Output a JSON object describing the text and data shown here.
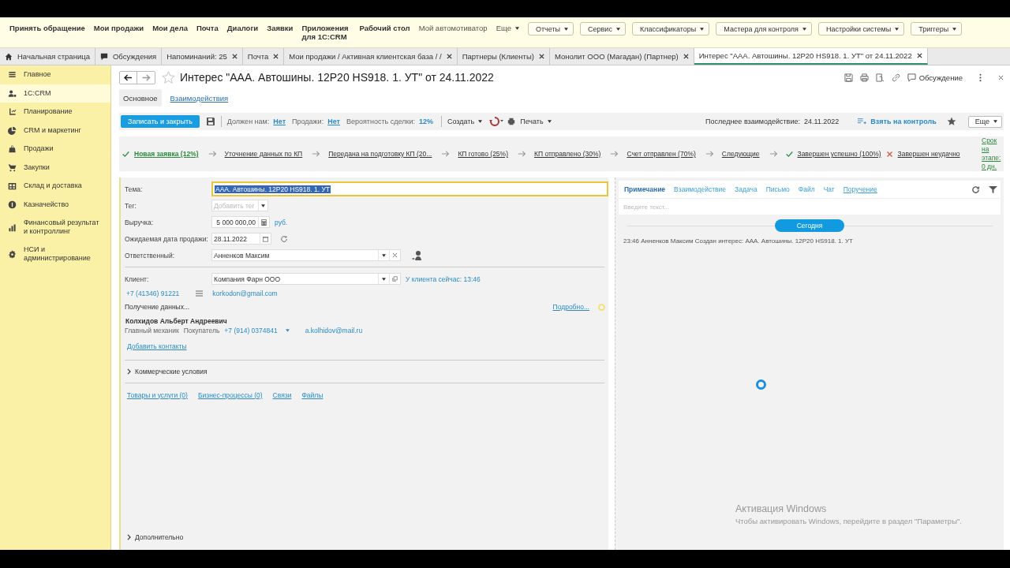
{
  "top_menu": [
    {
      "label": "Принять обращение",
      "kind": "bold"
    },
    {
      "label": "Мои продажи",
      "kind": "bold"
    },
    {
      "label": "Мои дела",
      "kind": "bold"
    },
    {
      "label": "Почта",
      "kind": "bold"
    },
    {
      "label": "Диалоги",
      "kind": "bold"
    },
    {
      "label": "Заявки",
      "kind": "bold"
    },
    {
      "label": "Приложения для 1С:CRM",
      "kind": "bold"
    },
    {
      "label": "Рабочий стол",
      "kind": "bold"
    },
    {
      "label": "Мой автомотиватор",
      "kind": "plain"
    },
    {
      "label": "Еще",
      "kind": "menu"
    },
    {
      "label": "Отчеты",
      "kind": "button"
    },
    {
      "label": "Сервис",
      "kind": "button"
    },
    {
      "label": "Классификаторы",
      "kind": "button"
    },
    {
      "label": "Мастера для контроля",
      "kind": "button"
    },
    {
      "label": "Настройки системы",
      "kind": "button"
    },
    {
      "label": "Триггеры",
      "kind": "button"
    }
  ],
  "open_tabs": [
    {
      "label": "Начальная страница",
      "kind": "home",
      "selected": false
    },
    {
      "label": "Обсуждения",
      "kind": "discussions",
      "selected": false
    },
    {
      "label": "Напоминаний: 25",
      "kind": "page",
      "selected": false
    },
    {
      "label": "Почта",
      "kind": "page",
      "selected": false
    },
    {
      "label": "Мои продажи / Активная клиентская база /  /",
      "kind": "page",
      "selected": false
    },
    {
      "label": "Партнеры (Клиенты)",
      "kind": "page",
      "selected": false
    },
    {
      "label": "Монолит ООО (Магадан) (Партнер)",
      "kind": "page",
      "selected": false
    },
    {
      "label": "Интерес \"ААА. Автошины. 12P20 HS918. 1. УТ\" от 24.11.2022",
      "kind": "page",
      "selected": true
    }
  ],
  "sidebar": {
    "items": [
      {
        "label": "Главное",
        "selected": false
      },
      {
        "label": "1С:CRM",
        "selected": true
      },
      {
        "label": "Планирование",
        "selected": false
      },
      {
        "label": "CRM и маркетинг",
        "selected": false
      },
      {
        "label": "Продажи",
        "selected": false
      },
      {
        "label": "Закупки",
        "selected": false
      },
      {
        "label": "Склад и доставка",
        "selected": false
      },
      {
        "label": "Казначейство",
        "selected": false
      },
      {
        "label": "Финансовый результат и контроллинг",
        "selected": false
      },
      {
        "label": "НСИ и администрирование",
        "selected": false
      }
    ]
  },
  "form": {
    "title": "Интерес \"ААА. Автошины. 12P20 HS918. 1. УТ\" от 24.11.2022",
    "discussion": "Обсуждение",
    "tabs": [
      {
        "label": "Основное",
        "selected": true
      },
      {
        "label": "Взаимодействия",
        "selected": false
      }
    ],
    "toolbar": {
      "save_close": "Записать и закрыть",
      "owes_label": "Должен нам:",
      "owes_value": "Нет",
      "sales_label": "Продажи:",
      "sales_value": "Нет",
      "probability_label": "Вероятность сделки:",
      "probability_value": "12%",
      "create": "Создать",
      "print": "Печать",
      "last_label": "Последнее взаимодействие:",
      "last_value": "24.11.2022",
      "control": "Взять на контроль",
      "more": "Еще"
    },
    "stages": [
      {
        "label": "Новая заявка (12%)",
        "kind": "current"
      },
      {
        "label": "Уточнение данных по КП",
        "kind": "step"
      },
      {
        "label": "Передана на подготовку КП (20...",
        "kind": "step"
      },
      {
        "label": "КП готово (25%)",
        "kind": "step"
      },
      {
        "label": "КП отправлено (30%)",
        "kind": "step"
      },
      {
        "label": "Счет отправлен (70%)",
        "kind": "step"
      },
      {
        "label": "Следующие",
        "kind": "step"
      },
      {
        "label": "Завершен успешно (100%)",
        "kind": "success"
      },
      {
        "label": "Завершен неудачно",
        "kind": "fail"
      }
    ],
    "stage_deadline": "Срок на этапе: 0 дн.",
    "fields": {
      "theme": {
        "label": "Тема:",
        "value": "ААА. Автошины. 12P20 HS918. 1. УТ"
      },
      "tag": {
        "label": "Тег:",
        "placeholder": "Добавить тег"
      },
      "revenue": {
        "label": "Выручка:",
        "value": "5 000 000,00",
        "unit": "руб."
      },
      "date": {
        "label": "Ожидаемая дата продажи:",
        "value": "28.11.2022"
      },
      "responsible": {
        "label": "Ответственный:",
        "value": "Анненков Максим"
      },
      "client": {
        "label": "Клиент:",
        "value": "Компания Фарн ООО",
        "client_time": "У клиента сейчас: 13:46"
      }
    },
    "client_phone": "+7 (41346) 91221",
    "client_email": "korkodon@gmail.com",
    "loading": "Получение данных...",
    "details": "Подробно...",
    "contact": {
      "name": "Колхидов Альберт Андреевич",
      "position": "Главный механик",
      "role": "Покупатель",
      "phone": "+7 (914) 0374841",
      "email": "a.kolhidov@mail.ru"
    },
    "add_contacts": "Добавить контакты",
    "commercial": {
      "label": "Коммерческие условия",
      "expanded": false
    },
    "links": [
      "Товары и услуги (0)",
      "Бизнес-процессы (0)",
      "Связи",
      "Файлы"
    ],
    "extra": {
      "label": "Дополнительно",
      "expanded": false
    }
  },
  "right_panel": {
    "tabs": [
      {
        "label": "Примечание",
        "selected": true
      },
      {
        "label": "Взаимодействие",
        "selected": false
      },
      {
        "label": "Задача",
        "selected": false
      },
      {
        "label": "Письмо",
        "selected": false
      },
      {
        "label": "Файл",
        "selected": false
      },
      {
        "label": "Чат",
        "selected": false
      },
      {
        "label": "Поручение",
        "selected": false
      }
    ],
    "input_placeholder": "Введите текст...",
    "date_chip": "Сегодня",
    "entries": [
      "23:46 Анненков Максим Создан интерес: ААА. Автошины. 12P20 HS918. 1. УТ"
    ]
  },
  "windows_activation": {
    "title": "Активация Windows",
    "text": "Чтобы активировать Windows, перейдите в раздел \"Параметры\"."
  }
}
